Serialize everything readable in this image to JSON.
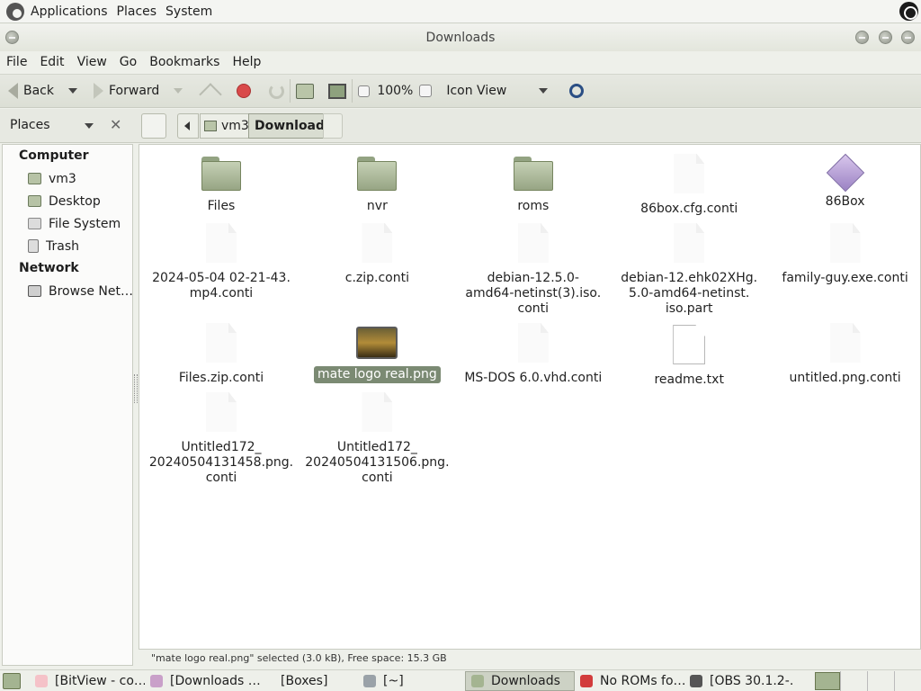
{
  "top_panel": {
    "menus": [
      "Applications",
      "Places",
      "System"
    ]
  },
  "window": {
    "title": "Downloads"
  },
  "menubar": [
    "File",
    "Edit",
    "View",
    "Go",
    "Bookmarks",
    "Help"
  ],
  "toolbar": {
    "back": "Back",
    "forward": "Forward",
    "zoom": "100%",
    "view_mode": "Icon View"
  },
  "location": {
    "side_pane_label": "Places",
    "crumbs": [
      "vm3",
      "Downloads"
    ]
  },
  "sidebar": {
    "sections": [
      {
        "heading": "Computer",
        "items": [
          "vm3",
          "Desktop",
          "File System",
          "Trash"
        ]
      },
      {
        "heading": "Network",
        "items": [
          "Browse Net…"
        ]
      }
    ]
  },
  "files": [
    {
      "name": "Files",
      "kind": "folder"
    },
    {
      "name": "nvr",
      "kind": "folder"
    },
    {
      "name": "roms",
      "kind": "folder"
    },
    {
      "name": "86box.cfg.conti",
      "kind": "ghost"
    },
    {
      "name": "86Box",
      "kind": "app"
    },
    {
      "name": "2024-05-04 02-21-43.\nmp4.conti",
      "kind": "ghost"
    },
    {
      "name": "c.zip.conti",
      "kind": "ghost"
    },
    {
      "name": "debian-12.5.0-\namd64-netinst(3).iso.\nconti",
      "kind": "ghost"
    },
    {
      "name": "debian-12.ehk02XHg.\n5.0-amd64-netinst.\niso.part",
      "kind": "ghost"
    },
    {
      "name": "family-guy.exe.conti",
      "kind": "ghost"
    },
    {
      "name": "Files.zip.conti",
      "kind": "ghost"
    },
    {
      "name": "mate logo real.png",
      "kind": "image",
      "selected": true
    },
    {
      "name": "MS-DOS 6.0.vhd.conti",
      "kind": "ghost"
    },
    {
      "name": "readme.txt",
      "kind": "doc"
    },
    {
      "name": "untitled.png.conti",
      "kind": "ghost"
    },
    {
      "name": "Untitled172_\n20240504131458.png.\nconti",
      "kind": "ghost"
    },
    {
      "name": "Untitled172_\n20240504131506.png.\nconti",
      "kind": "ghost"
    }
  ],
  "status": "\"mate logo real.png\" selected (3.0 kB), Free space: 15.3 GB",
  "taskbar": [
    {
      "label": "[BitView - co…",
      "color": "#f5c2c8"
    },
    {
      "label": "[Downloads …",
      "color": "#c9a0c9"
    },
    {
      "label": "[Boxes]",
      "color": ""
    },
    {
      "label": "[~]",
      "color": "#9aa2a8"
    },
    {
      "label": "Downloads",
      "color": "#a4b491",
      "active": true
    },
    {
      "label": "No ROMs fo…",
      "color": "#d23c3c"
    },
    {
      "label": "[OBS 30.1.2-…",
      "color": "#555555"
    }
  ]
}
